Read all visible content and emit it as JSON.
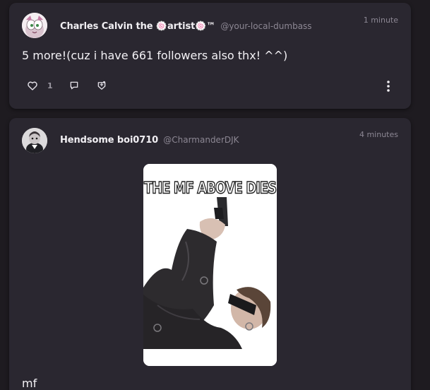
{
  "posts": [
    {
      "author": {
        "display_name": "Charles Calvin the 🍥artist🍥™",
        "handle": "@your-local-dumbass"
      },
      "time": "1 minute",
      "text": "5 more!(cuz i have 661 followers also thx! ^^)",
      "actions": {
        "like_icon": "heart-icon",
        "like_count": "1",
        "reply_icon": "reply-icon",
        "boost_icon": "boost-icon",
        "more_icon": "more-vertical-icon"
      }
    },
    {
      "author": {
        "display_name": "Hendsome boi0710",
        "handle": "@CharmanderDJK"
      },
      "time": "4 minutes",
      "media": {
        "caption": "THE MF ABOVE DIES"
      },
      "text": "mf"
    }
  ],
  "colors": {
    "background": "#1e1b20",
    "card": "#2a2730",
    "text": "#f3f1f5",
    "muted": "#8c8793"
  }
}
